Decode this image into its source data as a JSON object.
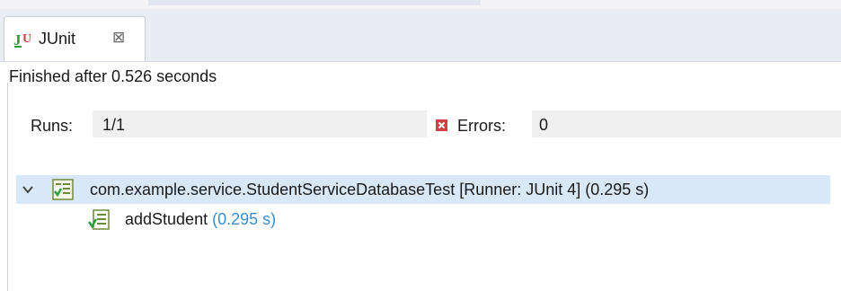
{
  "tab": {
    "title": "JUnit",
    "icon": "junit-icon",
    "close_icon": "close-icon"
  },
  "status": {
    "text": "Finished after 0.526 seconds"
  },
  "stats": {
    "runs_label": "Runs:",
    "runs_value": "1/1",
    "errors_label": "Errors:",
    "errors_value": "0"
  },
  "tree": {
    "suite": {
      "label": "com.example.service.StudentServiceDatabaseTest [Runner: JUnit 4] (0.295 s)",
      "icon": "test-suite-icon",
      "expanded": true
    },
    "cases": [
      {
        "name": "addStudent",
        "time": "(0.295 s)",
        "icon": "test-case-pass-icon"
      }
    ]
  },
  "colors": {
    "selection": "#d9e8f7",
    "time": "#3a8fd0",
    "error": "#d04040",
    "pass": "#2e9e3e"
  }
}
